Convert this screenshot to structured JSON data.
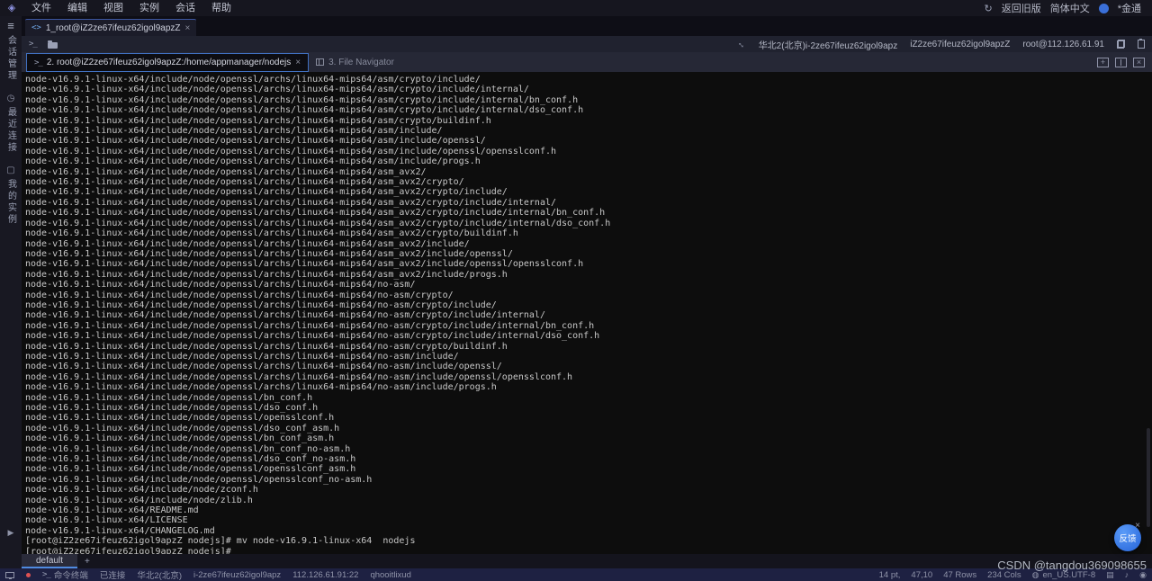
{
  "menu": {
    "items": [
      "文件",
      "编辑",
      "视图",
      "实例",
      "会话",
      "帮助"
    ],
    "right": {
      "back_old_label": "返回旧版",
      "language_label": "简体中文",
      "account_label": "*金通"
    }
  },
  "session_tabbar": {
    "tab": {
      "label": "1_root@iZ2ze67ifeuz62igol9apzZ",
      "close": "×"
    }
  },
  "toolbar": {
    "region": "华北2(北京)i-2ze67ifeuz62igol9apz",
    "instance": "iZ2ze67ifeuz62igol9apzZ",
    "user_host": "root@112.126.61.91"
  },
  "sidebar": {
    "items": [
      "会话管理",
      "最近连接",
      "我的实例"
    ]
  },
  "terminal_tabbar": {
    "tabs": [
      {
        "label": "2. root@iZ2ze67ifeuz62igol9apzZ:/home/appmanager/nodejs",
        "close": "×"
      },
      {
        "label": "3. File Navigator"
      }
    ]
  },
  "terminal": {
    "lines": [
      "node-v16.9.1-linux-x64/include/node/openssl/archs/linux64-mips64/asm/crypto/include/",
      "node-v16.9.1-linux-x64/include/node/openssl/archs/linux64-mips64/asm/crypto/include/internal/",
      "node-v16.9.1-linux-x64/include/node/openssl/archs/linux64-mips64/asm/crypto/include/internal/bn_conf.h",
      "node-v16.9.1-linux-x64/include/node/openssl/archs/linux64-mips64/asm/crypto/include/internal/dso_conf.h",
      "node-v16.9.1-linux-x64/include/node/openssl/archs/linux64-mips64/asm/crypto/buildinf.h",
      "node-v16.9.1-linux-x64/include/node/openssl/archs/linux64-mips64/asm/include/",
      "node-v16.9.1-linux-x64/include/node/openssl/archs/linux64-mips64/asm/include/openssl/",
      "node-v16.9.1-linux-x64/include/node/openssl/archs/linux64-mips64/asm/include/openssl/opensslconf.h",
      "node-v16.9.1-linux-x64/include/node/openssl/archs/linux64-mips64/asm/include/progs.h",
      "node-v16.9.1-linux-x64/include/node/openssl/archs/linux64-mips64/asm_avx2/",
      "node-v16.9.1-linux-x64/include/node/openssl/archs/linux64-mips64/asm_avx2/crypto/",
      "node-v16.9.1-linux-x64/include/node/openssl/archs/linux64-mips64/asm_avx2/crypto/include/",
      "node-v16.9.1-linux-x64/include/node/openssl/archs/linux64-mips64/asm_avx2/crypto/include/internal/",
      "node-v16.9.1-linux-x64/include/node/openssl/archs/linux64-mips64/asm_avx2/crypto/include/internal/bn_conf.h",
      "node-v16.9.1-linux-x64/include/node/openssl/archs/linux64-mips64/asm_avx2/crypto/include/internal/dso_conf.h",
      "node-v16.9.1-linux-x64/include/node/openssl/archs/linux64-mips64/asm_avx2/crypto/buildinf.h",
      "node-v16.9.1-linux-x64/include/node/openssl/archs/linux64-mips64/asm_avx2/include/",
      "node-v16.9.1-linux-x64/include/node/openssl/archs/linux64-mips64/asm_avx2/include/openssl/",
      "node-v16.9.1-linux-x64/include/node/openssl/archs/linux64-mips64/asm_avx2/include/openssl/opensslconf.h",
      "node-v16.9.1-linux-x64/include/node/openssl/archs/linux64-mips64/asm_avx2/include/progs.h",
      "node-v16.9.1-linux-x64/include/node/openssl/archs/linux64-mips64/no-asm/",
      "node-v16.9.1-linux-x64/include/node/openssl/archs/linux64-mips64/no-asm/crypto/",
      "node-v16.9.1-linux-x64/include/node/openssl/archs/linux64-mips64/no-asm/crypto/include/",
      "node-v16.9.1-linux-x64/include/node/openssl/archs/linux64-mips64/no-asm/crypto/include/internal/",
      "node-v16.9.1-linux-x64/include/node/openssl/archs/linux64-mips64/no-asm/crypto/include/internal/bn_conf.h",
      "node-v16.9.1-linux-x64/include/node/openssl/archs/linux64-mips64/no-asm/crypto/include/internal/dso_conf.h",
      "node-v16.9.1-linux-x64/include/node/openssl/archs/linux64-mips64/no-asm/crypto/buildinf.h",
      "node-v16.9.1-linux-x64/include/node/openssl/archs/linux64-mips64/no-asm/include/",
      "node-v16.9.1-linux-x64/include/node/openssl/archs/linux64-mips64/no-asm/include/openssl/",
      "node-v16.9.1-linux-x64/include/node/openssl/archs/linux64-mips64/no-asm/include/openssl/opensslconf.h",
      "node-v16.9.1-linux-x64/include/node/openssl/archs/linux64-mips64/no-asm/include/progs.h",
      "node-v16.9.1-linux-x64/include/node/openssl/bn_conf.h",
      "node-v16.9.1-linux-x64/include/node/openssl/dso_conf.h",
      "node-v16.9.1-linux-x64/include/node/openssl/opensslconf.h",
      "node-v16.9.1-linux-x64/include/node/openssl/dso_conf_asm.h",
      "node-v16.9.1-linux-x64/include/node/openssl/bn_conf_asm.h",
      "node-v16.9.1-linux-x64/include/node/openssl/bn_conf_no-asm.h",
      "node-v16.9.1-linux-x64/include/node/openssl/dso_conf_no-asm.h",
      "node-v16.9.1-linux-x64/include/node/openssl/opensslconf_asm.h",
      "node-v16.9.1-linux-x64/include/node/openssl/opensslconf_no-asm.h",
      "node-v16.9.1-linux-x64/include/node/zconf.h",
      "node-v16.9.1-linux-x64/include/node/zlib.h",
      "node-v16.9.1-linux-x64/README.md",
      "node-v16.9.1-linux-x64/LICENSE",
      "node-v16.9.1-linux-x64/CHANGELOG.md",
      "[root@iZ2ze67ifeuz62igol9apzZ nodejs]# mv node-v16.9.1-linux-x64  nodejs",
      "[root@iZ2ze67ifeuz62igol9apzZ nodejs]#"
    ]
  },
  "bottom_tabbar": {
    "active_tab": "default",
    "add_button": "+"
  },
  "statusbar": {
    "left": {
      "terminal_label": "命令终端",
      "connection_status": "已连接",
      "region": "华北2(北京)",
      "instance_id": "i-2ze67ifeuz62igol9apz",
      "address": "112.126.61.91:22",
      "session_id": "qhooitlixud"
    },
    "right": {
      "font_size": "14 pt,",
      "cursor_position": "47,10",
      "rows": "47 Rows",
      "cols": "234 Cols",
      "encoding": "en_US.UTF-8"
    }
  },
  "watermark": "CSDN @tangdou369098655",
  "feedback": {
    "label": "反馈",
    "close": "×"
  },
  "colors": {
    "accent_blue": "#4070c0",
    "terminal_bg": "#0d0d0d",
    "status_bar": "#1e2142"
  }
}
